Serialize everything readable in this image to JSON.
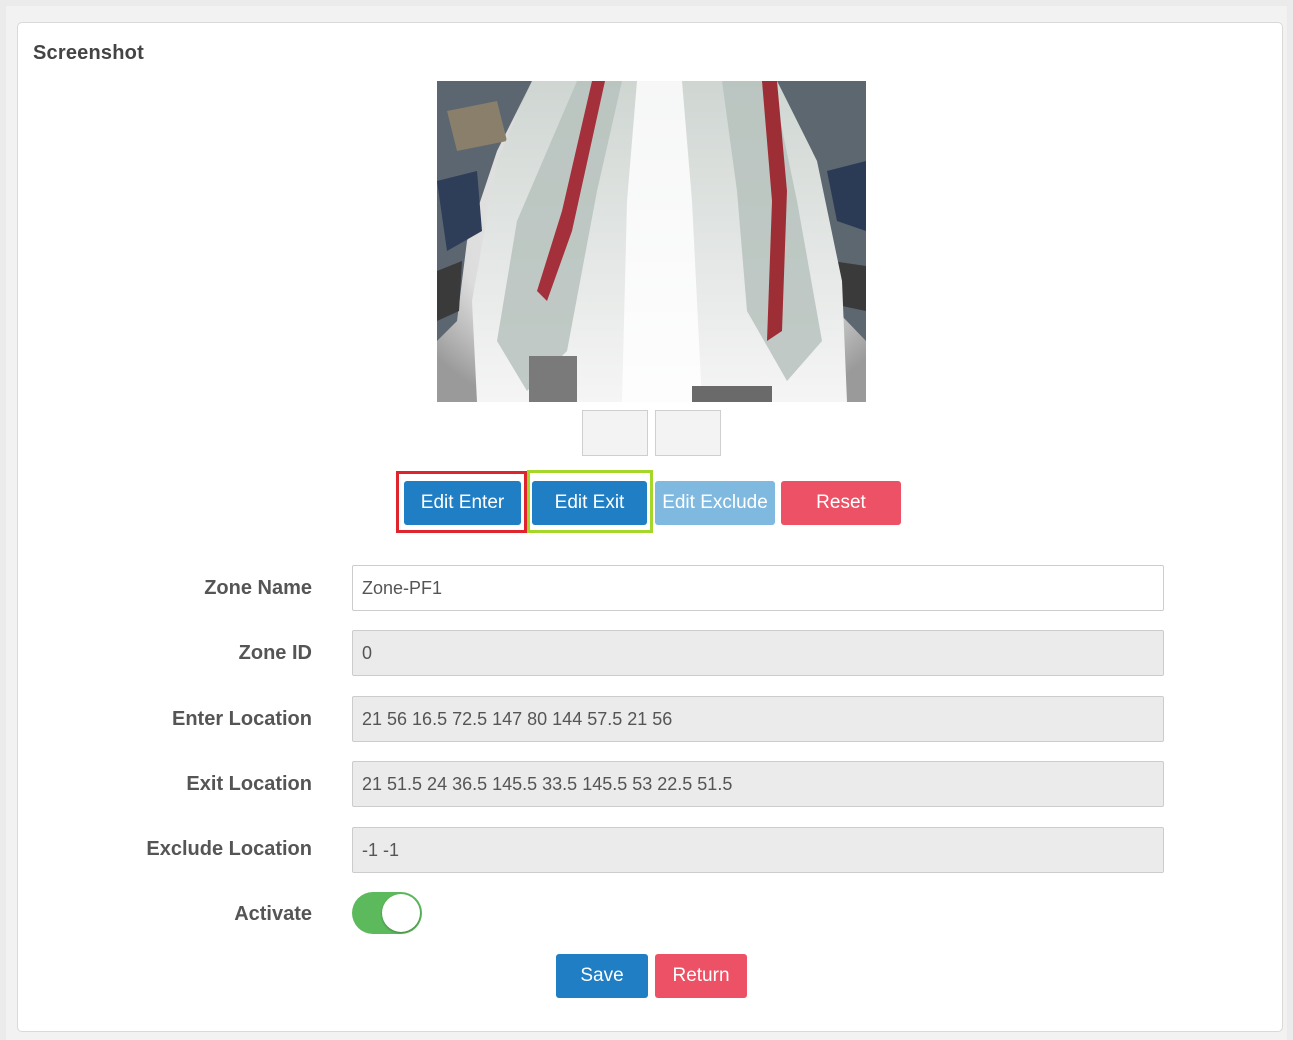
{
  "panel": {
    "title": "Screenshot"
  },
  "editor_buttons": {
    "edit_enter": "Edit Enter",
    "edit_exit": "Edit Exit",
    "edit_exclude": "Edit Exclude",
    "reset": "Reset"
  },
  "form": {
    "zone_name": {
      "label": "Zone Name",
      "value": "Zone-PF1"
    },
    "zone_id": {
      "label": "Zone ID",
      "value": "0"
    },
    "enter_location": {
      "label": "Enter Location",
      "value": "21 56 16.5 72.5 147 80 144 57.5 21 56"
    },
    "exit_location": {
      "label": "Exit Location",
      "value": "21 51.5 24 36.5 145.5 33.5 145.5 53 22.5 51.5"
    },
    "exclude_location": {
      "label": "Exclude Location",
      "value": "-1 -1"
    },
    "activate": {
      "label": "Activate",
      "checked": true
    }
  },
  "footer": {
    "save": "Save",
    "return": "Return"
  },
  "colors": {
    "primary": "#1f7ec4",
    "danger": "#ec5165",
    "light_primary": "#7fb9e0",
    "toggle_on": "#5cba5c",
    "highlight_enter": "#e0242e",
    "highlight_exit": "#a5d62a"
  }
}
